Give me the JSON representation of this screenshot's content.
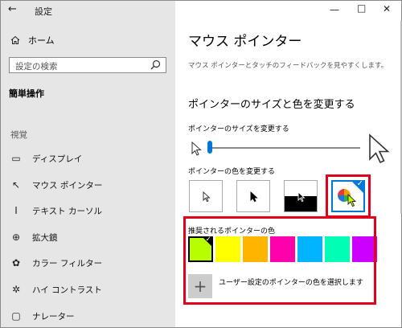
{
  "window": {
    "title": "設定",
    "back_glyph": "←"
  },
  "sidebar": {
    "home_label": "ホーム",
    "search_placeholder": "設定の検索",
    "section_title": "簡単操作",
    "category": "視覚",
    "items": [
      {
        "label": "ディスプレイ",
        "icon": "display-icon"
      },
      {
        "label": "マウス ポインター",
        "icon": "mouse-pointer-icon"
      },
      {
        "label": "テキスト カーソル",
        "icon": "text-cursor-icon"
      },
      {
        "label": "拡大鏡",
        "icon": "magnifier-icon"
      },
      {
        "label": "カラー フィルター",
        "icon": "color-filter-icon"
      },
      {
        "label": "ハイ コントラスト",
        "icon": "high-contrast-icon"
      },
      {
        "label": "ナレーター",
        "icon": "narrator-icon"
      }
    ]
  },
  "main": {
    "title": "マウス ポインター",
    "description": "マウス ポインターとタッチのフィードバックを見やすくします。",
    "heading": "ポインターのサイズと色を変更する",
    "size_label": "ポインターのサイズを変更する",
    "size_value_fraction": 0.04,
    "color_label": "ポインターの色を変更する",
    "pointer_color_options": [
      "white",
      "black",
      "inverted",
      "custom"
    ],
    "selected_color_option": "custom",
    "recommended_title": "推奨されるポインターの色",
    "recommended_colors": [
      "#b7ff00",
      "#ffff00",
      "#ffb400",
      "#ff00aa",
      "#00b4ff",
      "#00ffb4",
      "#cc00ff"
    ],
    "selected_recommended": 0,
    "custom_label": "ユーザー設定のポインターの色を選択します",
    "accent_color": "#0078d7",
    "highlight_color": "#e0001b"
  }
}
